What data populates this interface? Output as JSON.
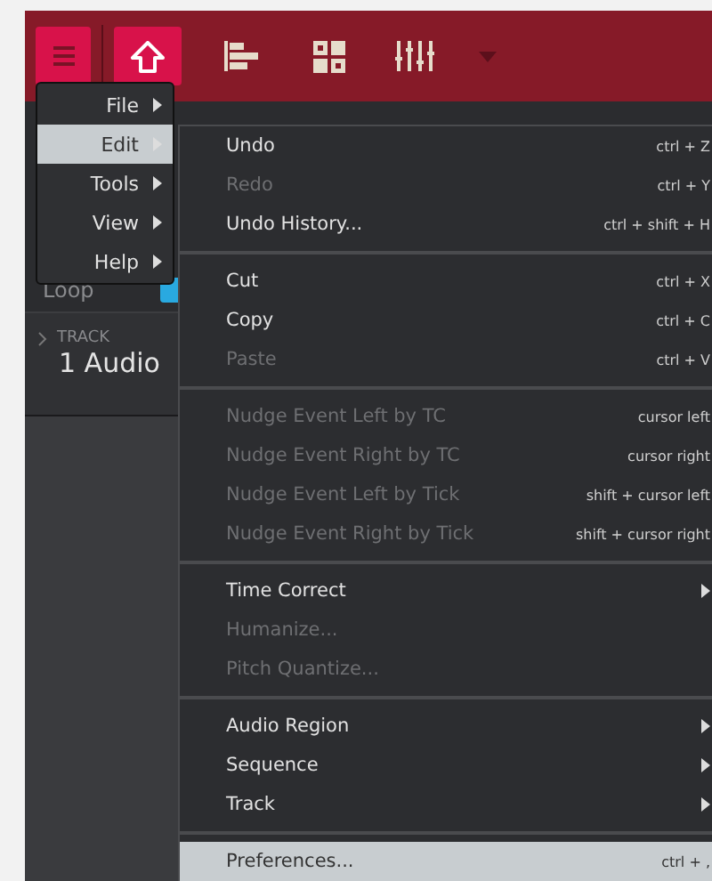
{
  "toolbar": {
    "buttons": [
      {
        "kind": "menu",
        "selected": true
      },
      {
        "kind": "home",
        "selected": true
      },
      {
        "kind": "tracks",
        "selected": false
      },
      {
        "kind": "grid",
        "selected": false
      },
      {
        "kind": "mixer",
        "selected": false
      },
      {
        "kind": "dropdown",
        "selected": false
      }
    ]
  },
  "background": {
    "loop_label": "Loop",
    "loop_on": true,
    "track_label": "TRACK",
    "track_name": "1 Audio"
  },
  "main_menu": {
    "items": [
      {
        "label": "File",
        "selected": false
      },
      {
        "label": "Edit",
        "selected": true
      },
      {
        "label": "Tools",
        "selected": false
      },
      {
        "label": "View",
        "selected": false
      },
      {
        "label": "Help",
        "selected": false
      }
    ]
  },
  "edit_menu": {
    "groups": [
      {
        "items": [
          {
            "label": "Undo",
            "shortcut": "ctrl + Z",
            "disabled": false,
            "submenu": false,
            "selected": false
          },
          {
            "label": "Redo",
            "shortcut": "ctrl + Y",
            "disabled": true,
            "submenu": false,
            "selected": false
          },
          {
            "label": "Undo History...",
            "shortcut": "ctrl + shift + H",
            "disabled": false,
            "submenu": false,
            "selected": false
          }
        ]
      },
      {
        "items": [
          {
            "label": "Cut",
            "shortcut": "ctrl + X",
            "disabled": false,
            "submenu": false,
            "selected": false
          },
          {
            "label": "Copy",
            "shortcut": "ctrl + C",
            "disabled": false,
            "submenu": false,
            "selected": false
          },
          {
            "label": "Paste",
            "shortcut": "ctrl + V",
            "disabled": true,
            "submenu": false,
            "selected": false
          }
        ]
      },
      {
        "items": [
          {
            "label": "Nudge Event Left by TC",
            "shortcut": "cursor left",
            "disabled": true,
            "submenu": false,
            "selected": false
          },
          {
            "label": "Nudge Event Right by TC",
            "shortcut": "cursor right",
            "disabled": true,
            "submenu": false,
            "selected": false
          },
          {
            "label": "Nudge Event Left by Tick",
            "shortcut": "shift + cursor left",
            "disabled": true,
            "submenu": false,
            "selected": false
          },
          {
            "label": "Nudge Event Right by Tick",
            "shortcut": "shift + cursor right",
            "disabled": true,
            "submenu": false,
            "selected": false
          }
        ]
      },
      {
        "items": [
          {
            "label": "Time Correct",
            "disabled": false,
            "submenu": true,
            "selected": false
          },
          {
            "label": "Humanize...",
            "disabled": true,
            "submenu": false,
            "selected": false
          },
          {
            "label": "Pitch Quantize...",
            "disabled": true,
            "submenu": false,
            "selected": false
          }
        ]
      },
      {
        "items": [
          {
            "label": "Audio Region",
            "disabled": false,
            "submenu": true,
            "selected": false
          },
          {
            "label": "Sequence",
            "disabled": false,
            "submenu": true,
            "selected": false
          },
          {
            "label": "Track",
            "disabled": false,
            "submenu": true,
            "selected": false
          }
        ]
      },
      {
        "items": [
          {
            "label": "Preferences...",
            "shortcut": "ctrl + ,",
            "disabled": false,
            "submenu": false,
            "selected": true
          }
        ]
      }
    ]
  }
}
